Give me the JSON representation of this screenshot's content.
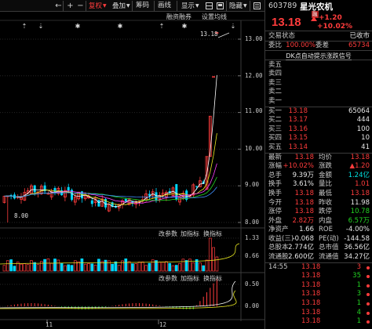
{
  "toolbar": {
    "fuquan_label": "复权",
    "diejia_label": "叠加",
    "chouma_label": "筹码",
    "huaxian_label": "画线",
    "xianshi_label": "显示",
    "yincang_label": "隐藏",
    "rongzi_label": "融资融券",
    "settings_label": "设置均线"
  },
  "chart": {
    "price_axis": [
      "13.00",
      "12.00",
      "11.00",
      "10.00",
      "9.00",
      "8.00"
    ],
    "vol_axis": [
      "1.33",
      "0.66"
    ],
    "macd_axis": [
      "0.50",
      "0.00"
    ],
    "high_label": "13.18",
    "low_label": "8.00",
    "date_labels": [
      "11",
      "12"
    ],
    "sub1_controls": [
      "改参数",
      "加指标",
      "换指标"
    ],
    "sub2_controls": [
      "改参数",
      "加指标",
      "换指标"
    ]
  },
  "quote": {
    "code": "603789",
    "name": "星光农机",
    "badge": "融",
    "price": "13.18",
    "change": "+1.20",
    "change_pct": "+10.02%",
    "status_label": "交易状态",
    "status_value": "已收市",
    "weibi_label": "委比",
    "weibi_value": "100.00%",
    "weicha_label": "委差",
    "weicha_value": "65734",
    "signal_text": "DK点自动提示涨跌信号",
    "sells": [
      {
        "label": "卖五",
        "price": "",
        "vol": ""
      },
      {
        "label": "卖四",
        "price": "",
        "vol": ""
      },
      {
        "label": "卖三",
        "price": "",
        "vol": ""
      },
      {
        "label": "卖二",
        "price": "",
        "vol": ""
      },
      {
        "label": "卖一",
        "price": "",
        "vol": ""
      }
    ],
    "buys": [
      {
        "label": "买一",
        "price": "13.18",
        "vol": "65064"
      },
      {
        "label": "买二",
        "price": "13.17",
        "vol": "444"
      },
      {
        "label": "买三",
        "price": "13.16",
        "vol": "100"
      },
      {
        "label": "买四",
        "price": "13.15",
        "vol": "10"
      },
      {
        "label": "买五",
        "price": "13.14",
        "vol": "41"
      }
    ],
    "stats": [
      {
        "l1": "最新",
        "v1": "13.18",
        "c1": "red",
        "l2": "均价",
        "v2": "13.18",
        "c2": "red"
      },
      {
        "l1": "涨幅",
        "v1": "+10.02%",
        "c1": "red",
        "l2": "涨跌",
        "v2": "▲1.20",
        "c2": "red"
      },
      {
        "l1": "总手",
        "v1": "9.39万",
        "c1": "white",
        "l2": "金额",
        "v2": "1.24亿",
        "c2": "cyan"
      },
      {
        "l1": "换手",
        "v1": "3.61%",
        "c1": "white",
        "l2": "量比",
        "v2": "1.01",
        "c2": "red"
      },
      {
        "l1": "换手",
        "v1": "13.18",
        "c1": "red",
        "l2": "最低",
        "v2": "13.18",
        "c2": "red"
      },
      {
        "l1": "今开",
        "v1": "13.18",
        "c1": "red",
        "l2": "昨收",
        "v2": "11.98",
        "c2": "white"
      },
      {
        "l1": "涨停",
        "v1": "13.18",
        "c1": "red",
        "l2": "跌停",
        "v2": "10.78",
        "c2": "green"
      },
      {
        "l1": "外盘",
        "v1": "2.82万",
        "c1": "red",
        "l2": "内盘",
        "v2": "6.57万",
        "c2": "green"
      },
      {
        "l1": "净资产",
        "v1": "1.66",
        "c1": "white",
        "l2": "ROE",
        "v2": "-4.00%",
        "c2": "white"
      },
      {
        "l1": "收益(三)",
        "v1": "-0.068",
        "c1": "white",
        "l2": "PE(动)",
        "v2": "-144.58",
        "c2": "white"
      },
      {
        "l1": "总股本",
        "v1": "2.774亿",
        "c1": "white",
        "l2": "总市值",
        "v2": "36.56亿",
        "c2": "white"
      },
      {
        "l1": "流通股",
        "v1": "2.600亿",
        "c1": "white",
        "l2": "流通值",
        "v2": "34.27亿",
        "c2": "white"
      }
    ],
    "ticks": [
      {
        "time": "14:55",
        "price": "13.18",
        "vol": "3",
        "vc": "red"
      },
      {
        "time": "",
        "price": "13.18",
        "vol": "35",
        "vc": "green"
      },
      {
        "time": "",
        "price": "13.18",
        "vol": "1",
        "vc": "green"
      },
      {
        "time": "",
        "price": "13.18",
        "vol": "3",
        "vc": "green"
      },
      {
        "time": "",
        "price": "13.18",
        "vol": "1",
        "vc": "green"
      },
      {
        "time": "",
        "price": "13.18",
        "vol": "4",
        "vc": "green"
      },
      {
        "time": "",
        "price": "13.18",
        "vol": "1",
        "vc": "green"
      }
    ]
  },
  "colors": {
    "up": "#ff3c3c",
    "down": "#22d422",
    "bg": "#000000"
  }
}
